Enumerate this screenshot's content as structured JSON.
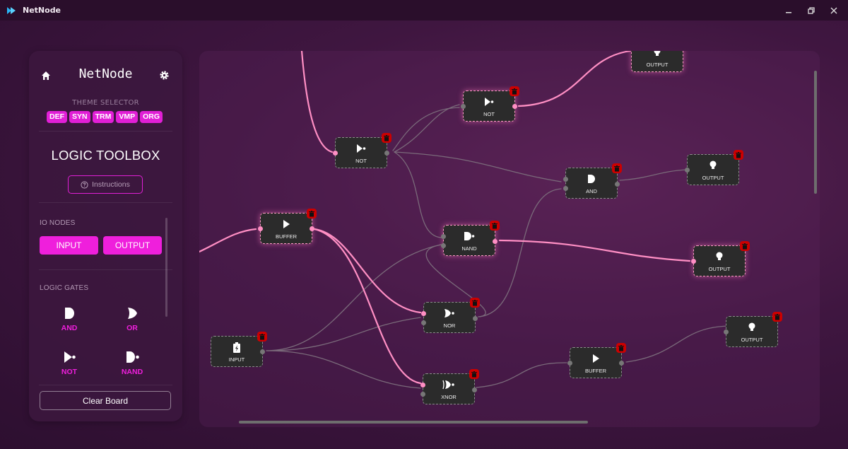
{
  "window": {
    "title": "NetNode",
    "controls": [
      "minimize",
      "restore",
      "close"
    ]
  },
  "sidebar": {
    "title": "NetNode",
    "theme_label": "THEME SELECTOR",
    "themes": [
      "DEF",
      "SYN",
      "TRM",
      "VMP",
      "ORG"
    ],
    "toolbox_title": "LOGIC TOOLBOX",
    "instructions_label": "Instructions",
    "io_section": "IO NODES",
    "io_input": "INPUT",
    "io_output": "OUTPUT",
    "gates_section": "LOGIC GATES",
    "gates": [
      "AND",
      "OR",
      "NOT",
      "NAND"
    ],
    "clear_label": "Clear Board",
    "accent": "#ef1fdc"
  },
  "board": {
    "nodes": {
      "not1": "NOT",
      "not2": "NOT",
      "buffer1": "BUFFER",
      "nand": "NAND",
      "and": "AND",
      "nor": "NOR",
      "xnor": "XNOR",
      "input": "INPUT",
      "buffer2": "BUFFER",
      "out_top": "OUTPUT",
      "out1": "OUTPUT",
      "out2": "OUTPUT",
      "out3": "OUTPUT"
    },
    "active_wire_color": "#ff8fc4",
    "idle_wire_color": "#7a6a7a",
    "delete_color": "#cc0000"
  }
}
